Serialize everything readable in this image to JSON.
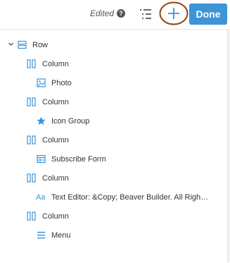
{
  "toolbar": {
    "edited_label": "Edited",
    "help_glyph": "?",
    "outline_icon": "outline-list-icon",
    "add_icon": "plus-icon",
    "done_label": "Done"
  },
  "outline": {
    "items": [
      {
        "label": "Row",
        "icon": "row-icon",
        "depth": 0,
        "expandable": true
      },
      {
        "label": "Column",
        "icon": "column-icon",
        "depth": 1
      },
      {
        "label": "Photo",
        "icon": "photo-icon",
        "depth": 2
      },
      {
        "label": "Column",
        "icon": "column-icon",
        "depth": 1
      },
      {
        "label": "Icon Group",
        "icon": "star-icon",
        "depth": 2
      },
      {
        "label": "Column",
        "icon": "column-icon",
        "depth": 1
      },
      {
        "label": "Subscribe Form",
        "icon": "table-icon",
        "depth": 2
      },
      {
        "label": "Column",
        "icon": "column-icon",
        "depth": 1
      },
      {
        "label": "Text Editor: &Copy; Beaver Builder. All Righ…",
        "icon": "text-editor-icon",
        "depth": 2,
        "icon_text": "Aa"
      },
      {
        "label": "Column",
        "icon": "column-icon",
        "depth": 1
      },
      {
        "label": "Menu",
        "icon": "menu-icon",
        "depth": 2
      }
    ]
  },
  "colors": {
    "accent": "#3d94d6",
    "icon_blue": "#3d94d6",
    "highlight_ring": "#8b4513",
    "text": "#333333"
  }
}
